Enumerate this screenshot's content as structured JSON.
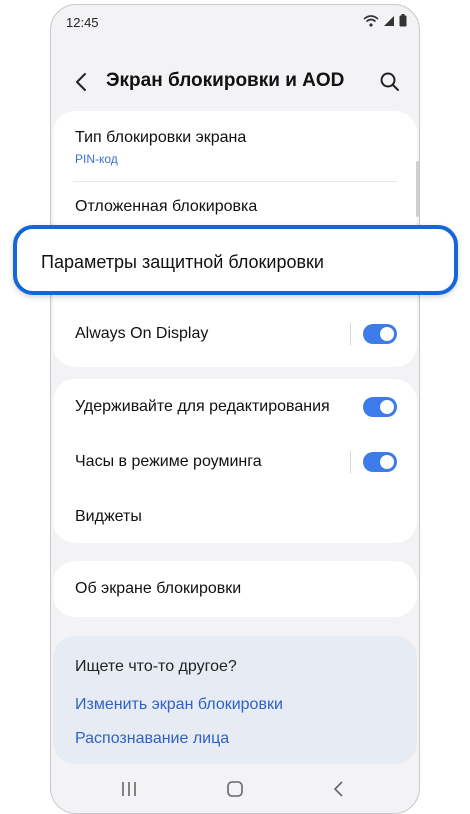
{
  "status_bar": {
    "time": "12:45",
    "icons": [
      "wifi-icon",
      "signal-icon",
      "battery-icon"
    ]
  },
  "header": {
    "title": "Экран блокировки и AOD",
    "back_icon": "back-chevron-icon",
    "search_icon": "search-icon"
  },
  "lock_type": {
    "label": "Тип блокировки экрана",
    "value": "PIN-код"
  },
  "deferred_lock": {
    "label": "Отложенная блокировка"
  },
  "highlighted": {
    "label": "Параметры защитной блокировки"
  },
  "always_on_display": {
    "label": "Always On Display",
    "enabled": true
  },
  "hold_to_edit": {
    "label": "Удерживайте для редактирования",
    "enabled": true
  },
  "roaming_clock": {
    "label": "Часы в режиме роуминга",
    "enabled": true
  },
  "widgets": {
    "label": "Виджеты"
  },
  "about_lock_screen": {
    "label": "Об экране блокировки"
  },
  "suggestions": {
    "title": "Ищете что-то другое?",
    "links": [
      "Изменить экран блокировки",
      "Распознавание лица"
    ]
  },
  "nav_bar": {
    "icons": [
      "recents-icon",
      "home-icon",
      "back-icon"
    ]
  },
  "colors": {
    "accent": "#3e7bea",
    "highlight_border": "#1467d8",
    "link": "#2f62c4"
  }
}
